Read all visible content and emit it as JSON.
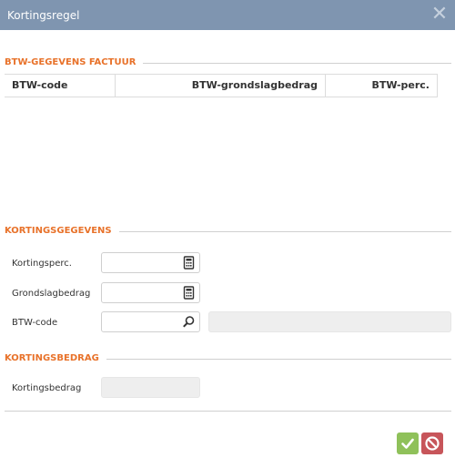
{
  "dialog": {
    "title": "Kortingsregel",
    "close_icon": "close-icon"
  },
  "sections": {
    "btw": "BTW-GEGEVENS FACTUUR",
    "korting": "KORTINGSGEGEVENS",
    "bedrag": "KORTINGSBEDRAG"
  },
  "table": {
    "columns": [
      "BTW-code",
      "BTW-grondslagbedrag",
      "BTW-perc."
    ],
    "rows": []
  },
  "fields": {
    "kortingsperc": {
      "label": "Kortingsperc.",
      "value": "",
      "icon": "calculator-icon"
    },
    "grondslagbedrag": {
      "label": "Grondslagbedrag",
      "value": "",
      "icon": "calculator-icon"
    },
    "btwcode": {
      "label": "BTW-code",
      "value": "",
      "description": "",
      "icon": "search-icon"
    },
    "kortingsbedrag": {
      "label": "Kortingsbedrag",
      "value": ""
    }
  },
  "buttons": {
    "ok_icon": "check-icon",
    "cancel_icon": "cancel-icon"
  },
  "colors": {
    "titlebar": "#7f95b0",
    "section": "#e8722a",
    "ok": "#8fc15a",
    "cancel": "#c7555a"
  }
}
